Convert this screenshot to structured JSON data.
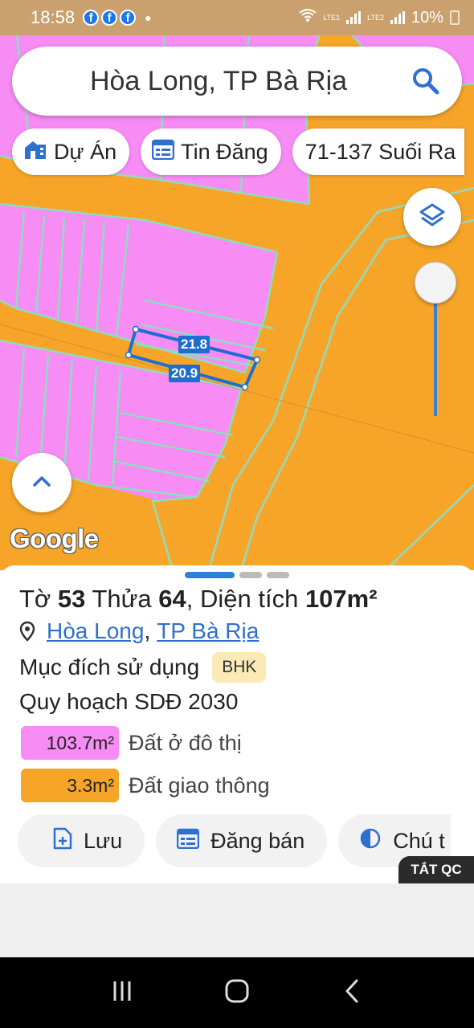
{
  "status": {
    "time": "18:58",
    "battery": "10%",
    "sim1": "LTE1",
    "sim2": "LTE2"
  },
  "search": {
    "text": "Hòa Long, TP Bà Rịa"
  },
  "chips": [
    {
      "label": "Dự Án",
      "icon": "building-icon"
    },
    {
      "label": "Tin Đăng",
      "icon": "calendar-list-icon"
    },
    {
      "label": "71-137 Suối Ra"
    }
  ],
  "map": {
    "edge_top": "21.8",
    "edge_bottom": "20.9",
    "google": "Google"
  },
  "parcel": {
    "to_label": "Tờ",
    "to_value": "53",
    "thua_label": "Thửa",
    "thua_value": "64",
    "area_label": "Diện tích",
    "area_value": "107m²",
    "ward": "Hòa Long",
    "separator": ",",
    "city": "TP Bà Rịa",
    "purpose_label": "Mục đích sử dụng",
    "purpose_code": "BHK",
    "plan_label": "Quy hoạch SDĐ 2030",
    "zones": [
      {
        "area": "103.7m²",
        "label": "Đất ở đô thị",
        "color": "#f78cf4"
      },
      {
        "area": "3.3m²",
        "label": "Đất giao thông",
        "color": "#f7a529"
      }
    ]
  },
  "actions": {
    "save": "Lưu",
    "post": "Đăng bán",
    "legend": "Chú t"
  },
  "ad": {
    "close_label": "TẮT QC"
  }
}
